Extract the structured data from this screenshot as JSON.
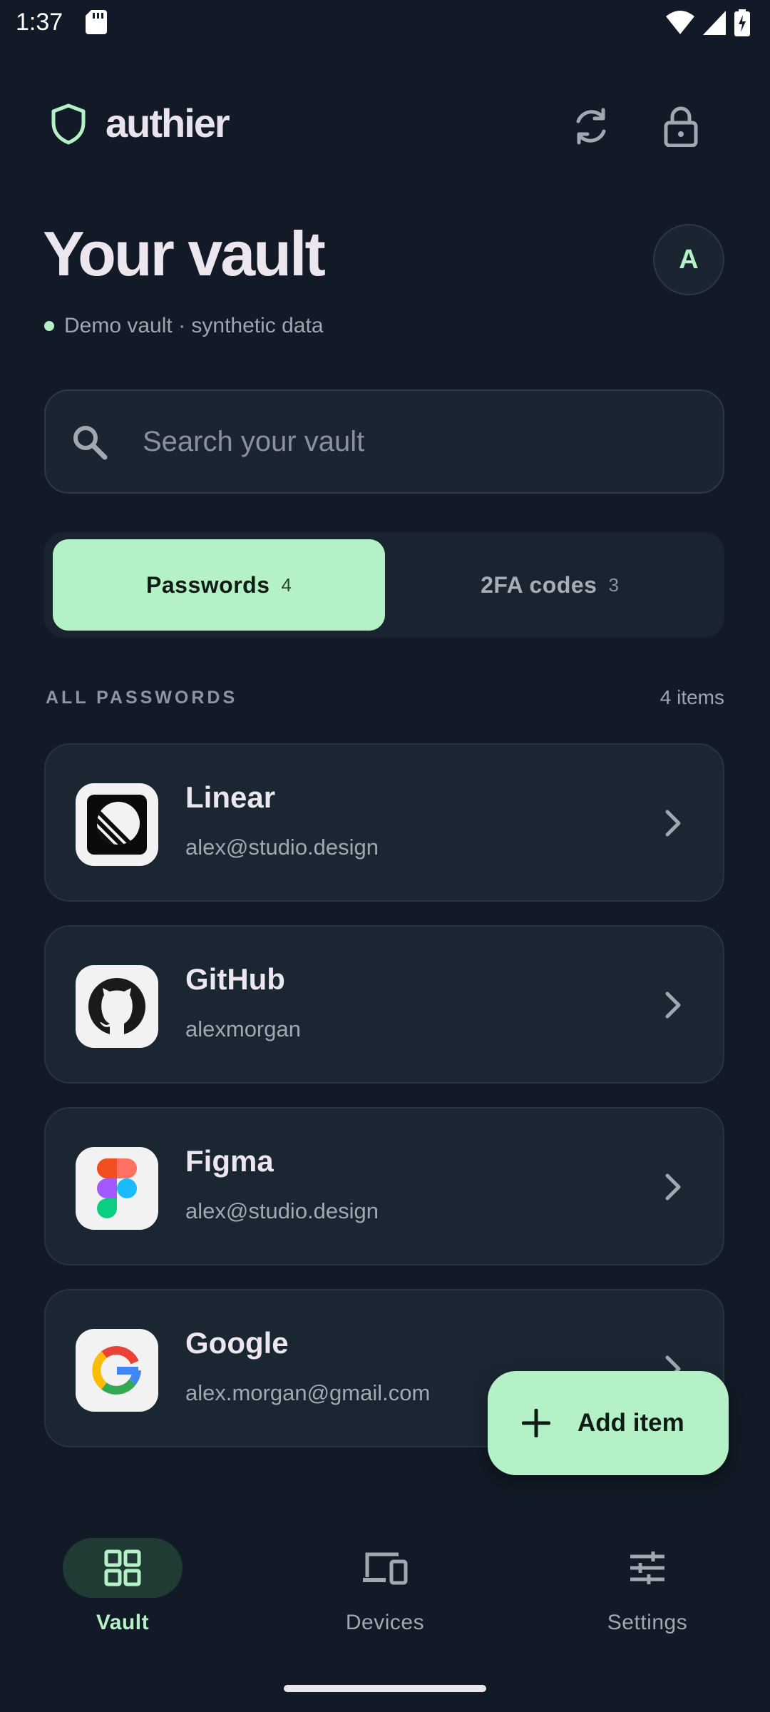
{
  "status_bar": {
    "time": "1:37"
  },
  "header": {
    "brand": "authier"
  },
  "vault": {
    "title": "Your vault",
    "subtitle": "Demo vault · synthetic data",
    "avatar_initial": "A"
  },
  "search": {
    "placeholder": "Search your vault",
    "value": ""
  },
  "tabs": [
    {
      "label": "Passwords",
      "count": "4",
      "active": true
    },
    {
      "label": "2FA codes",
      "count": "3",
      "active": false
    }
  ],
  "list": {
    "section_label": "ALL PASSWORDS",
    "count_label": "4 items",
    "items": [
      {
        "name": "Linear",
        "username": "alex@studio.design",
        "icon": "linear-logo-icon"
      },
      {
        "name": "GitHub",
        "username": "alexmorgan",
        "icon": "github-logo-icon"
      },
      {
        "name": "Figma",
        "username": "alex@studio.design",
        "icon": "figma-logo-icon"
      },
      {
        "name": "Google",
        "username": "alex.morgan@gmail.com",
        "icon": "google-logo-icon"
      }
    ]
  },
  "fab": {
    "label": "Add item"
  },
  "nav": [
    {
      "label": "Vault",
      "icon": "grid-icon",
      "active": true
    },
    {
      "label": "Devices",
      "icon": "devices-icon",
      "active": false
    },
    {
      "label": "Settings",
      "icon": "sliders-icon",
      "active": false
    }
  ],
  "colors": {
    "background": "#111a26",
    "accent": "#b5f1c7",
    "card": "#1b2633"
  }
}
